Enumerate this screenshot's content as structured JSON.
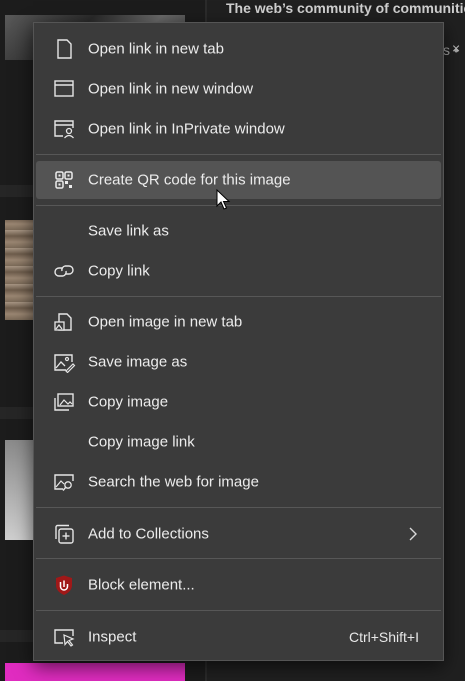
{
  "background": {
    "header_text": "The web’s community of communities",
    "sub_text": "s •",
    "close_glyph": "×"
  },
  "menu": {
    "items": [
      {
        "label": "Open link in new tab",
        "icon": "new-tab-icon"
      },
      {
        "label": "Open link in new window",
        "icon": "new-window-icon"
      },
      {
        "label": "Open link in InPrivate window",
        "icon": "inprivate-window-icon"
      },
      {
        "label": "Create QR code for this image",
        "icon": "qr-code-icon",
        "hovered": true
      },
      {
        "label": "Save link as",
        "icon": ""
      },
      {
        "label": "Copy link",
        "icon": "link-icon"
      },
      {
        "label": "Open image in new tab",
        "icon": "image-new-tab-icon"
      },
      {
        "label": "Save image as",
        "icon": "save-image-icon"
      },
      {
        "label": "Copy image",
        "icon": "copy-image-icon"
      },
      {
        "label": "Copy image link",
        "icon": ""
      },
      {
        "label": "Search the web for image",
        "icon": "image-search-icon"
      },
      {
        "label": "Add to Collections",
        "icon": "collections-icon",
        "submenu": true
      },
      {
        "label": "Block element...",
        "icon": "ublock-shield-icon"
      },
      {
        "label": "Inspect",
        "icon": "inspect-icon",
        "shortcut": "Ctrl+Shift+I"
      }
    ]
  },
  "colors": {
    "menu_bg": "#3b3b3b",
    "hover_bg": "#545454",
    "text": "#ececec",
    "ublock_red": "#a01818"
  }
}
